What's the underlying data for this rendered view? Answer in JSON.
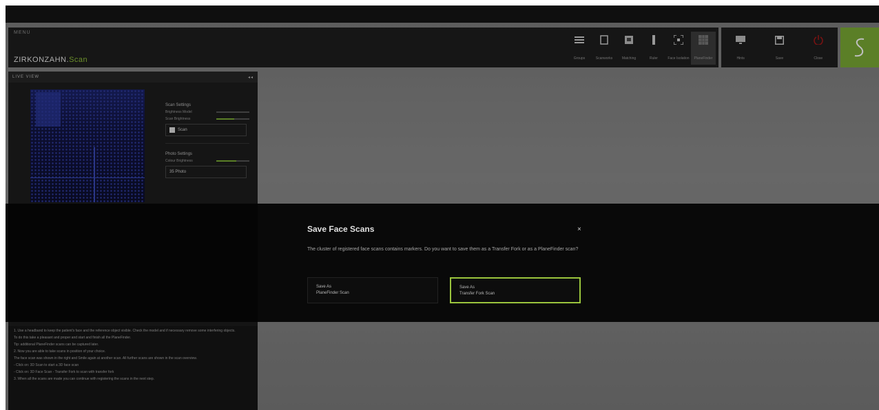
{
  "app": {
    "menu_label": "MENU",
    "logo_main": "ZIRKONZAHN.",
    "logo_suffix": "Scan"
  },
  "toolbar": {
    "tools": [
      {
        "label": "Groups",
        "icon": "list-icon"
      },
      {
        "label": "Scanworks",
        "icon": "book-icon"
      },
      {
        "label": "Matching",
        "icon": "image-icon"
      },
      {
        "label": "Ruler",
        "icon": "ruler-icon"
      },
      {
        "label": "Face Isolation",
        "icon": "crop-icon"
      },
      {
        "label": "PlaneFinder",
        "icon": "grid-icon"
      }
    ],
    "right_tools": [
      {
        "label": "Hints",
        "icon": "monitor-icon"
      },
      {
        "label": "Save",
        "icon": "save-icon"
      },
      {
        "label": "Close",
        "icon": "power-icon"
      }
    ],
    "accent": "#7aaa34"
  },
  "live_view": {
    "title": "LIVE VIEW",
    "collapse": "◂◂",
    "scan_settings": {
      "heading": "Scan Settings",
      "brightness_label": "Brightness Model",
      "scan_brightness_label": "Scan Brightness",
      "value_label": "Scan"
    },
    "photo_settings": {
      "heading": "Photo Settings",
      "brightness_label": "Colour Brightness",
      "value": "35",
      "value_unit": "Photo"
    },
    "instructions": [
      "1. Use a headband to keep the patient's face and the reference object visible. Check the model and if necessary remove some interfering objects.",
      "To do this take a pleasant and proper and start and finish all the PlaneFinder.",
      "Tip: additional PlaneFinder scans can be captured later.",
      "2. Now you are able to take scans in position of your choice.",
      "The face scan was shown in the right and Smile again at another scan. All further scans are shown in the scan overview.",
      "- Click on: 3D Scan to start a 3D face scan",
      "- Click on: 3D Face Scan - Transfer Fork to scan with transfer fork",
      "3. When all the scans are made you can continue with registering the scans in the next step."
    ]
  },
  "dialog": {
    "title": "Save Face Scans",
    "close_icon": "×",
    "message": "The cluster of registered face scans contains markers. Do you want to save them as a Transfer Fork or as a PlaneFinder scan?",
    "option1": {
      "line1": "Save As",
      "line2": "PlaneFinder Scan"
    },
    "option2": {
      "line1": "Save As",
      "line2": "Transfer Fork Scan"
    },
    "highlight_color": "#9bc53d"
  }
}
